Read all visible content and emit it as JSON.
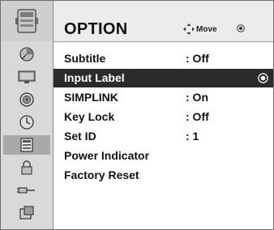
{
  "header": {
    "title": "OPTION",
    "move_label": "Move"
  },
  "sidebar": {
    "items": [
      {
        "icon": "picture-icon"
      },
      {
        "icon": "screen-icon"
      },
      {
        "icon": "audio-icon"
      },
      {
        "icon": "time-icon"
      },
      {
        "icon": "option-icon",
        "selected": true
      },
      {
        "icon": "lock-icon"
      },
      {
        "icon": "input-icon"
      },
      {
        "icon": "usb-icon"
      }
    ]
  },
  "menu": {
    "items": [
      {
        "label": "Subtitle",
        "value": ": Off"
      },
      {
        "label": "Input Label",
        "value": "",
        "selected": true
      },
      {
        "label": "SIMPLINK",
        "value": ": On"
      },
      {
        "label": "Key Lock",
        "value": ": Off"
      },
      {
        "label": "Set ID",
        "value": ": 1"
      },
      {
        "label": "Power Indicator",
        "value": ""
      },
      {
        "label": "Factory Reset",
        "value": ""
      }
    ]
  },
  "colors": {
    "selected_row": "#2b2b2b",
    "sidebar_bg": "#d9d9d9",
    "sidebar_selected": "#a9a9a9"
  }
}
